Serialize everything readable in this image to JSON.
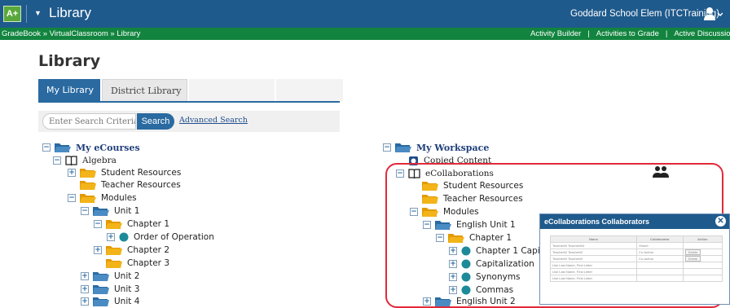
{
  "app": {
    "logo": "A+",
    "title": "Library",
    "school": "Goddard School Elem (ITCTraining)",
    "user_icon": "user-icon"
  },
  "breadcrumb": "GradeBook » VirtualClassroom » Library",
  "top_links": [
    "Activity Builder",
    "Activities to Grade",
    "Active Discussio"
  ],
  "page_title": "Library",
  "tabs": [
    "My Library",
    "District Library"
  ],
  "search": {
    "placeholder": "Enter Search Criteria",
    "button": "Search",
    "advanced": "Advanced Search"
  },
  "left_tree": {
    "root": "My eCourses",
    "course": "Algebra",
    "items": {
      "student_resources": "Student Resources",
      "teacher_resources": "Teacher Resources",
      "modules": "Modules",
      "unit1": "Unit 1",
      "chapter1": "Chapter 1",
      "order": "Order of Operation",
      "chapter2": "Chapter 2",
      "chapter3": "Chapter 3",
      "unit2": "Unit 2",
      "unit3": "Unit 3",
      "unit4": "Unit 4"
    }
  },
  "right_tree": {
    "root": "My Workspace",
    "copied": "Copied Content",
    "collab": "eCollaborations",
    "items": {
      "student_resources": "Student Resources",
      "teacher_resources": "Teacher Resources",
      "modules": "Modules",
      "english_unit1": "English Unit 1",
      "chapter1": "Chapter 1",
      "chapter1_capital": "Chapter 1 Capita",
      "capitalization": "Capitalization",
      "synonyms": "Synonyms",
      "commas": "Commas",
      "english_unit2": "English Unit 2"
    }
  },
  "collab_dialog": {
    "title": "eCollaborations Collaborators",
    "headers": [
      "Name",
      "Collaborator",
      "Action"
    ],
    "rows": [
      [
        "TeacherW TeacherW4",
        "Owner",
        ""
      ],
      [
        "TeacherW TeacherW",
        "Co-Author",
        "Delete"
      ],
      [
        "TeacherW TeacherW",
        "Co-Author",
        "Delete"
      ],
      [
        "Use Last Name, First Letter",
        "",
        ""
      ],
      [
        "Use Last Name, First Letter",
        "",
        ""
      ],
      [
        "Use Last Name, First Letter",
        "",
        ""
      ]
    ]
  },
  "colors": {
    "topbar": "#1f5a8c",
    "greenbar": "#12843f",
    "accent": "#2a6aa1",
    "folder": "#f2b418",
    "highlight_box": "#e12a3a"
  }
}
